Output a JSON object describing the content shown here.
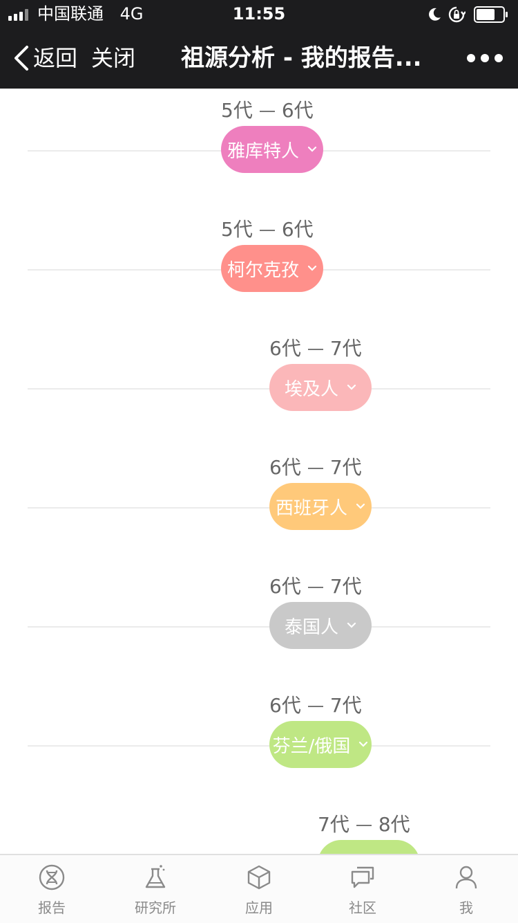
{
  "status_bar": {
    "carrier": "中国联通",
    "network": "4G",
    "time": "11:55"
  },
  "nav": {
    "back_label": "返回",
    "close_label": "关闭",
    "title": "祖源分析 - 我的报告..."
  },
  "timeline": [
    {
      "gen_from": "5代",
      "gen_to": "6代",
      "label": "雅库特人",
      "color": "#ee7fbe"
    },
    {
      "gen_from": "5代",
      "gen_to": "6代",
      "label": "柯尔克孜",
      "color": "#ff908b"
    },
    {
      "gen_from": "6代",
      "gen_to": "7代",
      "label": "埃及人",
      "color": "#fbb7b9"
    },
    {
      "gen_from": "6代",
      "gen_to": "7代",
      "label": "西班牙人",
      "color": "#ffc97a"
    },
    {
      "gen_from": "6代",
      "gen_to": "7代",
      "label": "泰国人",
      "color": "#c9c9c9"
    },
    {
      "gen_from": "6代",
      "gen_to": "7代",
      "label": "芬兰/俄国",
      "color": "#bfe784"
    },
    {
      "gen_from": "7代",
      "gen_to": "8代",
      "label": "",
      "color": "#bfe784"
    }
  ],
  "tabs": [
    {
      "label": "报告",
      "icon": "dna-icon"
    },
    {
      "label": "研究所",
      "icon": "flask-icon"
    },
    {
      "label": "应用",
      "icon": "cube-icon"
    },
    {
      "label": "社区",
      "icon": "chat-icon"
    },
    {
      "label": "我",
      "icon": "person-icon"
    }
  ]
}
